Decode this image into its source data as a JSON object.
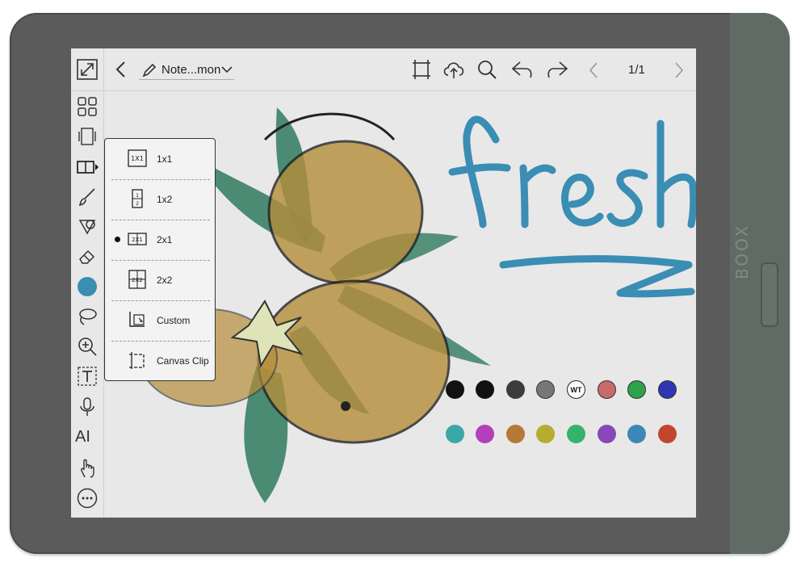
{
  "device": {
    "brand": "BOOX"
  },
  "toolbar": {
    "doc_title": "Note...mon",
    "page_indicator": "1/1"
  },
  "sidebar": {
    "ai_label": "AI"
  },
  "layout_menu": {
    "items": [
      {
        "label": "1x1",
        "icon": "1X1",
        "selected": false
      },
      {
        "label": "1x2",
        "icon": "1x2",
        "selected": false
      },
      {
        "label": "2x1",
        "icon": "2X1",
        "selected": true
      },
      {
        "label": "2x2",
        "icon": "2X2",
        "selected": false
      },
      {
        "label": "Custom",
        "icon": "custom-icon",
        "selected": false
      },
      {
        "label": "Canvas Clip",
        "icon": "canvas-clip-icon",
        "selected": false
      }
    ]
  },
  "canvas": {
    "handwritten_text": "fresh",
    "handwriting_color": "#3a8db3"
  },
  "palette": {
    "row1": [
      "#111111",
      "#111111",
      "#3c3c3c",
      "#777777",
      "WT",
      "#c86a6c",
      "#2fa24c",
      "#2f36b3"
    ],
    "row2": [
      "#3aa8a6",
      "#b43fb8",
      "#b57a36",
      "#b7ac2f",
      "#35b26b",
      "#8747b8",
      "#3c86b8",
      "#c2462f"
    ],
    "wt_label": "WT"
  },
  "icons": [
    "expand-icon",
    "back-icon",
    "pen-icon",
    "chevron-down-icon",
    "crop-icon",
    "cloud-sync-icon",
    "search-icon",
    "undo-icon",
    "redo-icon",
    "prev-page-icon",
    "next-page-icon",
    "grid-icon",
    "page-icon",
    "layout-icon",
    "brush-icon",
    "shape-icon",
    "eraser-icon",
    "color-icon",
    "lasso-icon",
    "zoom-icon",
    "text-icon",
    "mic-icon",
    "gesture-icon",
    "more-icon"
  ]
}
